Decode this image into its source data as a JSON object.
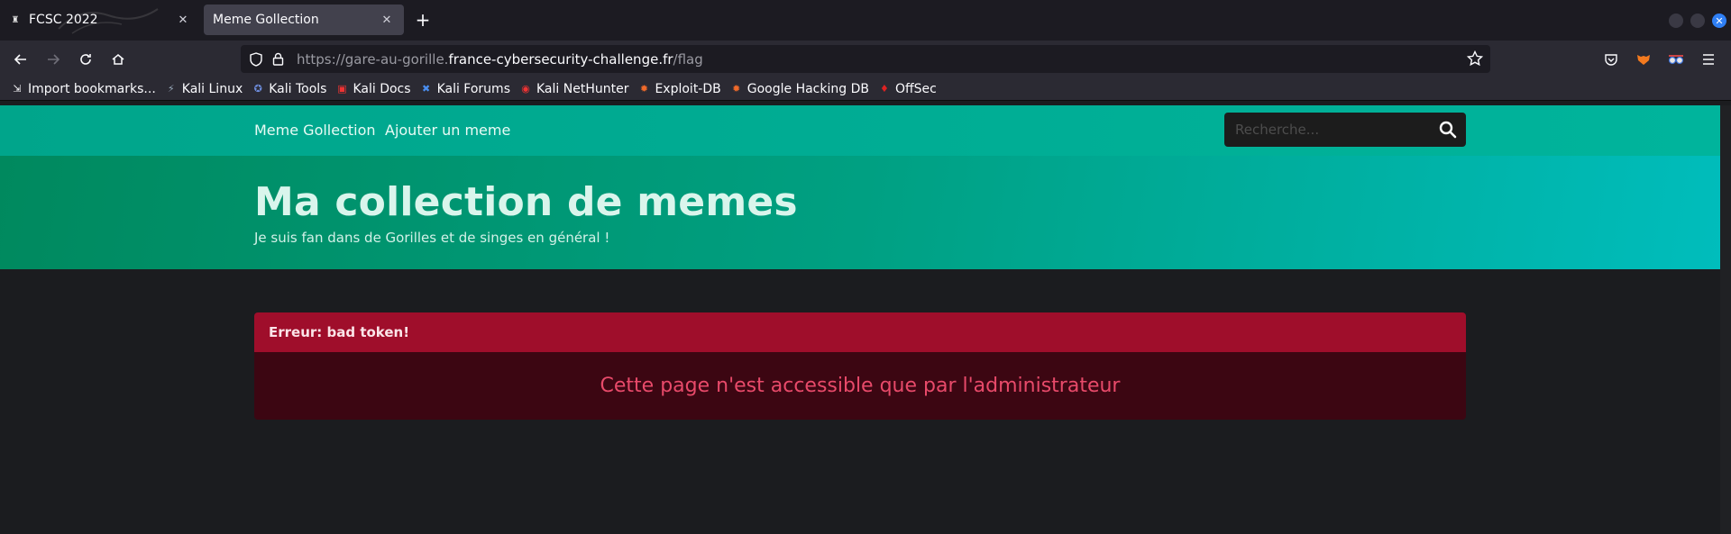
{
  "browser": {
    "tabs": [
      {
        "label": "FCSC 2022",
        "active": false
      },
      {
        "label": "Meme Gollection",
        "active": true
      }
    ],
    "url": {
      "prefix": "https://gare-au-gorille.",
      "host": "france-cybersecurity-challenge.fr",
      "path": "/flag"
    },
    "bookmarks": [
      {
        "label": "Import bookmarks...",
        "icon": "import-icon"
      },
      {
        "label": "Kali Linux",
        "icon": "kali-icon"
      },
      {
        "label": "Kali Tools",
        "icon": "kali-tools-icon"
      },
      {
        "label": "Kali Docs",
        "icon": "kali-docs-icon"
      },
      {
        "label": "Kali Forums",
        "icon": "kali-forums-icon"
      },
      {
        "label": "Kali NetHunter",
        "icon": "nethunter-icon"
      },
      {
        "label": "Exploit-DB",
        "icon": "exploitdb-icon"
      },
      {
        "label": "Google Hacking DB",
        "icon": "ghdb-icon"
      },
      {
        "label": "OffSec",
        "icon": "offsec-icon"
      }
    ]
  },
  "site": {
    "nav": {
      "brand": "Meme Gollection",
      "add": "Ajouter un meme",
      "search_placeholder": "Recherche..."
    },
    "hero": {
      "title": "Ma collection de memes",
      "subtitle": "Je suis fan dans de Gorilles et de singes en général !"
    },
    "alert": {
      "heading": "Erreur: bad token!",
      "message": "Cette page n'est accessible que par l'administrateur"
    }
  },
  "colors": {
    "accent": "#00a58b",
    "error_head": "#9f0e2b",
    "error_body": "#3c0612",
    "error_text": "#e84a6a"
  }
}
